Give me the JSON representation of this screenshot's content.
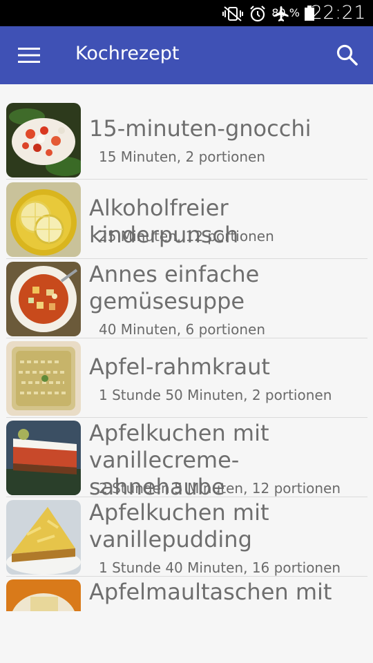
{
  "status_bar": {
    "battery_percent": "80 %",
    "time": "22:21",
    "icons": [
      "vibrate-off-icon",
      "alarm-icon",
      "airplane-icon",
      "battery-icon"
    ]
  },
  "app_bar": {
    "title": "Kochrezept",
    "menu_icon": "menu-icon",
    "search_icon": "search-icon",
    "color": "#3f51b5"
  },
  "recipes": [
    {
      "title": "15-minuten-gnocchi",
      "meta": "15 Minuten, 2 portionen",
      "thumb": "gnocchi-photo"
    },
    {
      "title": "Alkoholfreier kinderpunsch",
      "meta": "25 Minuten, 12 portionen",
      "thumb": "punch-photo"
    },
    {
      "title": "Annes einfache gemüsesuppe",
      "meta": "40 Minuten, 6 portionen",
      "thumb": "soup-photo"
    },
    {
      "title": "Apfel-rahmkraut",
      "meta": "1 Stunde 50 Minuten, 2 portionen",
      "thumb": "sauerkraut-photo"
    },
    {
      "title": "Apfelkuchen mit vanillecreme-sahnehaube",
      "meta": "2 Stunden 5 Minuten, 12 portionen",
      "thumb": "cake-cream-photo"
    },
    {
      "title": "Apfelkuchen mit vanillepudding",
      "meta": "1 Stunde 40 Minuten, 16 portionen",
      "thumb": "cake-pudding-photo"
    },
    {
      "title": "Apfelmaultaschen mit",
      "meta": "",
      "thumb": "maultaschen-photo"
    }
  ]
}
